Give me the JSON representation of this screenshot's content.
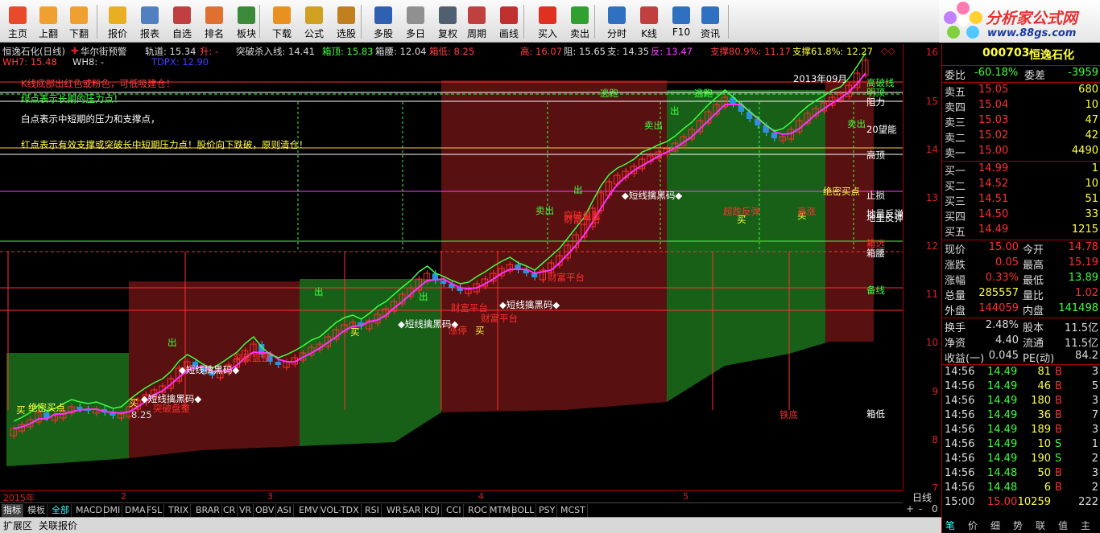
{
  "toolbar": {
    "buttons": [
      {
        "label": "主页",
        "icon": "home-icon",
        "color": "#e84a2a"
      },
      {
        "label": "上翻",
        "icon": "arrow-up-icon",
        "color": "#f0a030"
      },
      {
        "label": "下翻",
        "icon": "arrow-down-icon",
        "color": "#f0a030"
      },
      {
        "label": "报价",
        "icon": "yen-icon",
        "color": "#e8b020"
      },
      {
        "label": "报表",
        "icon": "report-icon",
        "color": "#5080c0"
      },
      {
        "label": "自选",
        "icon": "f6-icon",
        "color": "#c04040"
      },
      {
        "label": "排名",
        "icon": "ranking-icon",
        "color": "#e07030"
      },
      {
        "label": "板块",
        "icon": "sector-icon",
        "color": "#3a8a3a"
      },
      {
        "label": "下载",
        "icon": "download-icon",
        "color": "#e89020"
      },
      {
        "label": "公式",
        "icon": "formula-icon",
        "color": "#d0a020"
      },
      {
        "label": "选股",
        "icon": "stock-pick-icon",
        "color": "#c08020"
      },
      {
        "label": "多股",
        "icon": "multi-stock-icon",
        "color": "#3060b0"
      },
      {
        "label": "多日",
        "icon": "clock-icon",
        "color": "#909090"
      },
      {
        "label": "复权",
        "icon": "adjust-icon",
        "color": "#506070"
      },
      {
        "label": "周期",
        "icon": "f8-icon",
        "color": "#c04040"
      },
      {
        "label": "画线",
        "icon": "draw-icon",
        "color": "#c03030"
      },
      {
        "label": "买入",
        "icon": "buy-icon",
        "color": "#e03020"
      },
      {
        "label": "卖出",
        "icon": "sell-icon",
        "color": "#30a030"
      },
      {
        "label": "分时",
        "icon": "timeshare-icon",
        "color": "#3070c0"
      },
      {
        "label": "K线",
        "icon": "kline-icon",
        "color": "#c04040"
      },
      {
        "label": "F10",
        "icon": "f10-icon",
        "color": "#3070c0"
      },
      {
        "label": "资讯",
        "icon": "news-icon",
        "color": "#3070c0"
      }
    ]
  },
  "logo": {
    "name": "分析家公式网",
    "url": "www.88gs.com"
  },
  "chart": {
    "stock_title": "恒逸石化(日线)",
    "broker": "华尔街预警",
    "track": "轨道: 15.34",
    "track_dir": "升: -",
    "break_line": "突破杀入线: 14.41",
    "box_top": "箱顶: 15.83",
    "box_bottom": "箱腰: 12.04",
    "box_low": "箱低: 8.25",
    "high": "高: 16.07",
    "resist": "阻: 15.65",
    "support": "支: 14.35",
    "rebound": "反: 13.47",
    "support1": "支撑80.9%: 11.17",
    "support2": "支撑61.8%: 12.27",
    "wh7": "WH7: 15.48",
    "wh8": "WH8: -",
    "tdpx": "TDPX: 12.90",
    "notes": [
      "K线底部出红色或粉色，可低吸建仓！",
      "绿点表示长期的压力点！",
      "白点表示中短期的压力和支撑点，",
      "红点表示有效支撑或突破长中短期压力点！股价向下跌破，原则清仓！"
    ],
    "date_label": "2013年09月",
    "right_labels": [
      "高破线",
      "明顶",
      "阻力",
      "20望能",
      "高顶",
      "止损",
      "地量反弹",
      "地里反弹",
      "箱远",
      "箱腰",
      "备线",
      "箱低"
    ],
    "signals": [
      "出",
      "出",
      "出",
      "出",
      "出",
      "买",
      "买",
      "买",
      "买",
      "买",
      "买",
      "卖出",
      "卖出",
      "卖出",
      "◆短线擒黑码◆",
      "◆短线擒黑码◆",
      "◆短线擒黑码◆",
      "◆短线擒黑码◆",
      "◆短线擒黑码◆",
      "财富平台",
      "财富平台",
      "财富平台",
      "财富平台",
      "突破盘整",
      "突破盘整",
      "突破盘整",
      "涨停",
      "铁底",
      "逃跑",
      "逃跑",
      "绝密买点",
      "绝密买点",
      "超跌反弹",
      "高涨"
    ],
    "low_mark": "8.25"
  },
  "chart_data": {
    "type": "candlestick",
    "title": "恒逸石化(日线)",
    "ylim": [
      6.8,
      16.3
    ],
    "yticks": [
      7.0,
      8.0,
      9.0,
      10.0,
      11.0,
      12.0,
      13.0,
      14.0,
      15.0,
      16.0
    ],
    "month_labels": [
      "2015年",
      "2",
      "3",
      "4",
      "5"
    ]
  },
  "period": "日线",
  "tabs": [
    "指标",
    "模板",
    "全部",
    "MACD",
    "DMI",
    "DMA",
    "FSL",
    "TRIX",
    "BRAR",
    "CR",
    "VR",
    "OBV",
    "ASI",
    "EMV",
    "VOL-TDX",
    "RSI",
    "WR",
    "SAR",
    "KDJ",
    "CCI",
    "ROC",
    "MTM",
    "BOLL",
    "PSY",
    "MCST"
  ],
  "zoom": [
    "+",
    "-",
    "0"
  ],
  "bottom": [
    "扩展区",
    "关联报价"
  ],
  "panel": {
    "code": "000703",
    "name": "恒逸石化",
    "wb_label": "委比",
    "wb_val": "-60.18%",
    "wc_label": "委差",
    "wc_val": "-3959",
    "asks": [
      [
        "卖五",
        "15.05",
        "680"
      ],
      [
        "卖四",
        "15.04",
        "10"
      ],
      [
        "卖三",
        "15.03",
        "47"
      ],
      [
        "卖二",
        "15.02",
        "42"
      ],
      [
        "卖一",
        "15.00",
        "4490"
      ]
    ],
    "bids": [
      [
        "买一",
        "14.99",
        "1"
      ],
      [
        "买二",
        "14.52",
        "10"
      ],
      [
        "买三",
        "14.51",
        "51"
      ],
      [
        "买四",
        "14.50",
        "33"
      ],
      [
        "买五",
        "14.49",
        "1215"
      ]
    ],
    "stats": [
      [
        "现价",
        "15.00",
        "今开",
        "14.78"
      ],
      [
        "涨跌",
        "0.05",
        "最高",
        "15.19"
      ],
      [
        "涨幅",
        "0.33%",
        "最低",
        "13.89"
      ],
      [
        "总量",
        "285557",
        "量比",
        "1.02"
      ],
      [
        "外盘",
        "144059",
        "内盘",
        "141498"
      ]
    ],
    "stats2": [
      [
        "换手",
        "2.48%",
        "股本",
        "11.5亿"
      ],
      [
        "净资",
        "4.40",
        "流通",
        "11.5亿"
      ],
      [
        "收益(一)",
        "0.045",
        "PE(动)",
        "84.2"
      ]
    ],
    "ticks": [
      [
        "14:56",
        "14.49",
        "81",
        "B",
        "3"
      ],
      [
        "14:56",
        "14.49",
        "46",
        "B",
        "5"
      ],
      [
        "14:56",
        "14.49",
        "180",
        "B",
        "3"
      ],
      [
        "14:56",
        "14.49",
        "36",
        "B",
        "7"
      ],
      [
        "14:56",
        "14.49",
        "189",
        "B",
        "3"
      ],
      [
        "14:56",
        "14.49",
        "10",
        "S",
        "1"
      ],
      [
        "14:56",
        "14.49",
        "190",
        "S",
        "2"
      ],
      [
        "14:56",
        "14.48",
        "50",
        "B",
        "3"
      ],
      [
        "14:56",
        "14.48",
        "6",
        "B",
        "2"
      ],
      [
        "15:00",
        "15.00",
        "10259",
        "",
        "222"
      ]
    ],
    "tabs": [
      "笔",
      "价",
      "细",
      "势",
      "联",
      "值",
      "主"
    ]
  }
}
